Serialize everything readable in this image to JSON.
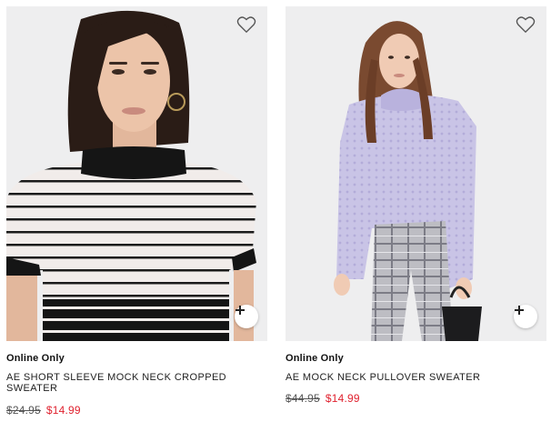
{
  "colors": {
    "sale": "#e0222f",
    "photo_bg": "#eeeeef"
  },
  "products": [
    {
      "badge": "Online Only",
      "name": "AE SHORT SLEEVE MOCK NECK CROPPED SWEATER",
      "original_price": "$24.95",
      "sale_price": "$14.99",
      "wishlist_icon": "heart-outline-icon",
      "quick_add_icon": "plus-icon"
    },
    {
      "badge": "Online Only",
      "name": "AE MOCK NECK PULLOVER SWEATER",
      "original_price": "$44.95",
      "sale_price": "$14.99",
      "wishlist_icon": "heart-outline-icon",
      "quick_add_icon": "plus-icon"
    }
  ]
}
